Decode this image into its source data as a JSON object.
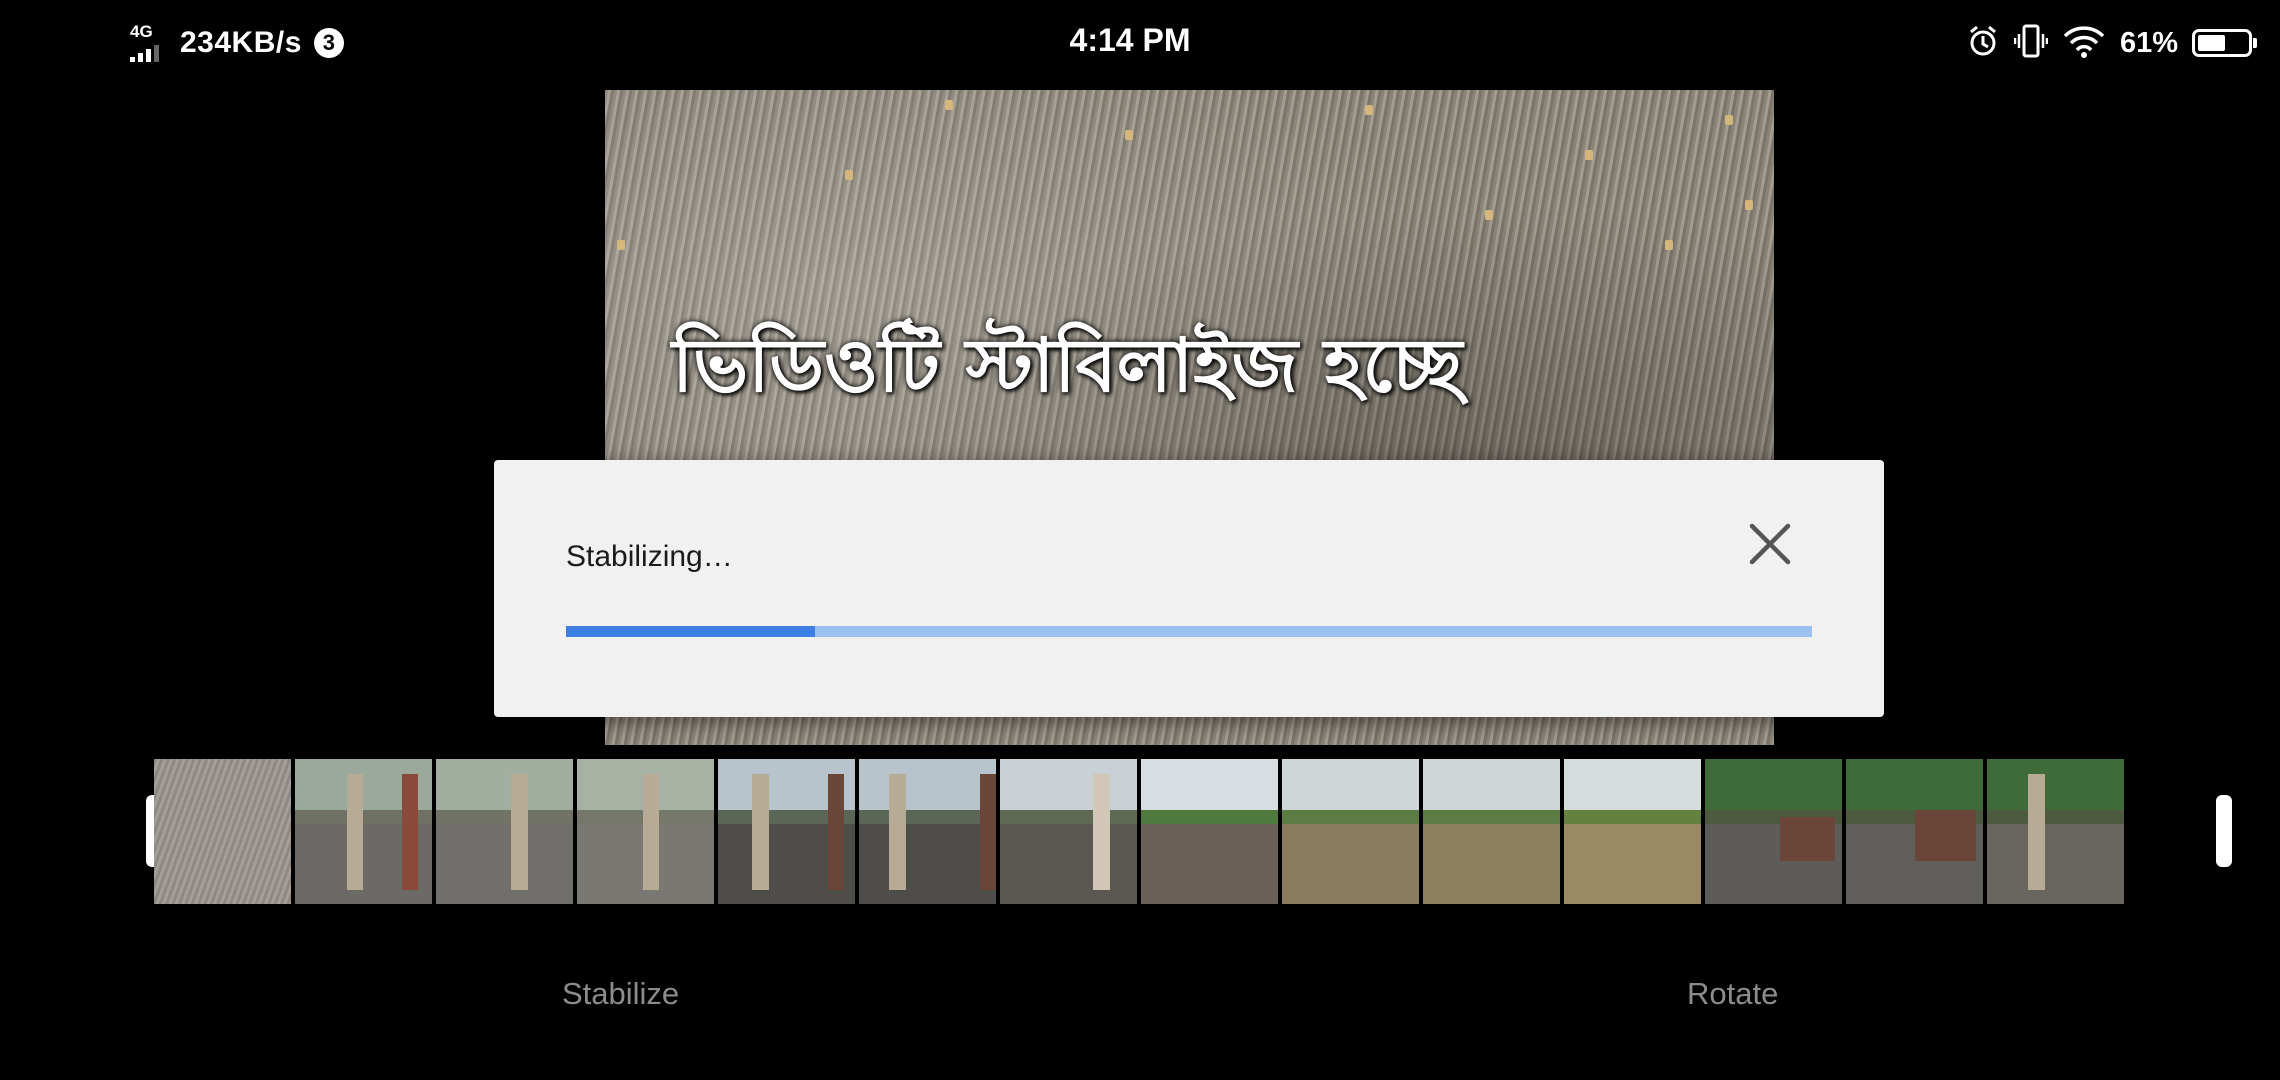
{
  "status_bar": {
    "network": "4G",
    "speed": "234KB/s",
    "notification_count": "3",
    "time": "4:14 PM",
    "battery_percent": "61%",
    "battery_level": 0.61
  },
  "video": {
    "caption": "ভিডিওটি স্টাবিলাইজ হচ্ছে"
  },
  "dialog": {
    "title": "Stabilizing…",
    "progress": 0.2
  },
  "tools": {
    "stabilize": "Stabilize",
    "rotate": "Rotate"
  },
  "colors": {
    "progress_fill": "#3d7fe0",
    "progress_track": "#9dc0f3",
    "dialog_bg": "#f2f1f1"
  }
}
